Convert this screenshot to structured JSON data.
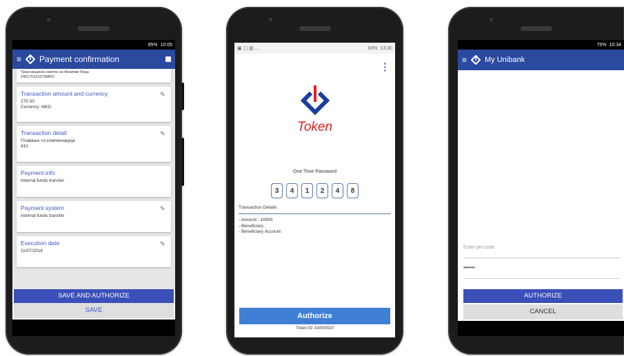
{
  "phone1": {
    "status_time": "10:05",
    "status_battery": "95%",
    "appbar_title": "Payment confirmation",
    "top_partial_text": "Трансакциска сметка на Физички Лица\n240170101070MKD",
    "cards": [
      {
        "title": "Transaction amount and currency",
        "line1": "275.00",
        "line2": "Currency: MKD",
        "editable": true
      },
      {
        "title": "Transaction detail",
        "line1": "Плаќање со компензација",
        "line2": "410",
        "editable": true
      },
      {
        "title": "Payment info",
        "line1": "Internal funds transfer",
        "line2": "",
        "editable": false
      },
      {
        "title": "Payment system",
        "line1": "Internal funds transfer",
        "line2": "",
        "editable": true
      },
      {
        "title": "Execution date",
        "line1": "11/07/2016",
        "line2": "",
        "editable": true
      }
    ],
    "save_authorize_label": "SAVE AND AUTHORIZE",
    "save_label": "SAVE"
  },
  "phone2": {
    "status_time": "13:30",
    "status_battery": "93%",
    "brand_name": "Token",
    "otp_label": "One Time Password",
    "otp_digits": [
      "3",
      "4",
      "1",
      "2",
      "4",
      "8"
    ],
    "details_heading": "Transaction Details",
    "details": [
      "- Amount : 10000",
      "- Beneficiary :",
      "- Beneficiary Account :"
    ],
    "authorize_label": "Authorize",
    "token_id": "Token ID: AA000020"
  },
  "phone3": {
    "status_time": "10:34",
    "status_battery": "75%",
    "appbar_title": "My Unibank",
    "pin_placeholder": "Enter pin code",
    "pin_value": "••••••",
    "authorize_label": "AUTHORIZE",
    "cancel_label": "CANCEL"
  },
  "colors": {
    "appbar": "#2a4aa0",
    "accent_blue": "#3b57c4",
    "token_red": "#e02020",
    "token_blue": "#1a3f9c",
    "authorize_btn": "#3f7fd6"
  },
  "icons": [
    "menu-icon",
    "unibank-logo-icon",
    "pencil-icon",
    "overflow-menu-icon",
    "token-logo-icon"
  ]
}
